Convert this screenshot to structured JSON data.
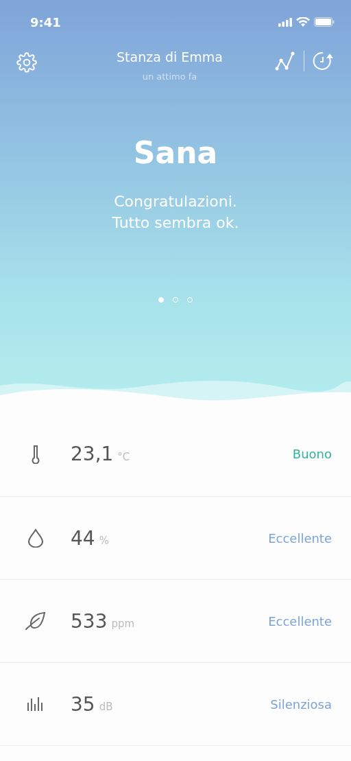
{
  "status_bar": {
    "time": "9:41"
  },
  "header": {
    "title": "Stanza di Emma",
    "subtitle": "un attimo fa"
  },
  "hero": {
    "status": "Sana",
    "message": [
      "Congratulazioni.",
      "Tutto sembra ok."
    ]
  },
  "pages": [
    {
      "selected": true
    },
    {
      "selected": false
    },
    {
      "selected": false
    }
  ],
  "readings": [
    {
      "kind": "temperature",
      "value": "23,1",
      "unit": "°C",
      "rating": "Buono",
      "color": "#2fb59a"
    },
    {
      "kind": "humidity",
      "value": "44",
      "unit": "%",
      "rating": "Eccellente",
      "color": "#7ba3d6"
    },
    {
      "kind": "co2",
      "value": "533",
      "unit": "ppm",
      "rating": "Eccellente",
      "color": "#7ba3d6"
    },
    {
      "kind": "noise",
      "value": "35",
      "unit": "dB",
      "rating": "Silenziosa",
      "color": "#7ba3d6"
    }
  ]
}
